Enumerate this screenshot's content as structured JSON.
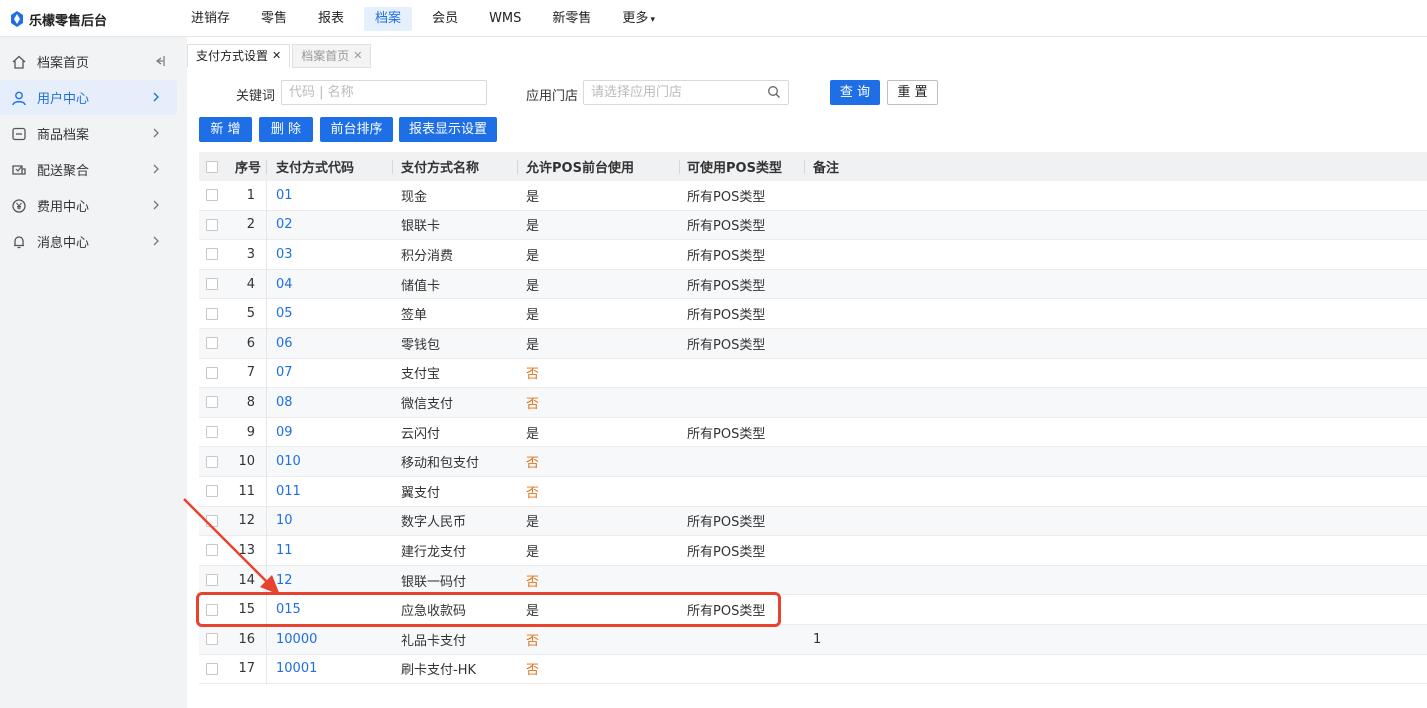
{
  "app": {
    "title": "乐檬零售后台"
  },
  "topnav": [
    {
      "label": "进销存",
      "active": false
    },
    {
      "label": "零售",
      "active": false
    },
    {
      "label": "报表",
      "active": false
    },
    {
      "label": "档案",
      "active": true
    },
    {
      "label": "会员",
      "active": false
    },
    {
      "label": "WMS",
      "active": false
    },
    {
      "label": "新零售",
      "active": false
    },
    {
      "label": "更多",
      "active": false
    }
  ],
  "sidebar": {
    "items": [
      {
        "label": "档案首页",
        "icon": "home-icon"
      },
      {
        "label": "用户中心",
        "icon": "user-icon",
        "active": true
      },
      {
        "label": "商品档案",
        "icon": "product-icon"
      },
      {
        "label": "配送聚合",
        "icon": "delivery-icon"
      },
      {
        "label": "费用中心",
        "icon": "yen-icon"
      },
      {
        "label": "消息中心",
        "icon": "bell-icon"
      }
    ]
  },
  "tabs": [
    {
      "label": "支付方式设置",
      "active": true
    },
    {
      "label": "档案首页",
      "active": false
    }
  ],
  "filter": {
    "keyword_label": "关键词",
    "keyword_placeholder": "代码 | 名称",
    "store_label": "应用门店",
    "store_placeholder": "请选择应用门店",
    "query_label": "查 询",
    "reset_label": "重 置"
  },
  "actions": {
    "add_label": "新 增",
    "delete_label": "删 除",
    "sort_label": "前台排序",
    "report_label": "报表显示设置"
  },
  "table": {
    "columns": [
      "序号",
      "支付方式代码",
      "支付方式名称",
      "允许POS前台使用",
      "可使用POS类型",
      "备注"
    ],
    "rows": [
      {
        "seq": "1",
        "code": "01",
        "name": "现金",
        "allow": "是",
        "pos_type": "所有POS类型",
        "remark": ""
      },
      {
        "seq": "2",
        "code": "02",
        "name": "银联卡",
        "allow": "是",
        "pos_type": "所有POS类型",
        "remark": ""
      },
      {
        "seq": "3",
        "code": "03",
        "name": "积分消费",
        "allow": "是",
        "pos_type": "所有POS类型",
        "remark": ""
      },
      {
        "seq": "4",
        "code": "04",
        "name": "储值卡",
        "allow": "是",
        "pos_type": "所有POS类型",
        "remark": ""
      },
      {
        "seq": "5",
        "code": "05",
        "name": "签单",
        "allow": "是",
        "pos_type": "所有POS类型",
        "remark": ""
      },
      {
        "seq": "6",
        "code": "06",
        "name": "零钱包",
        "allow": "是",
        "pos_type": "所有POS类型",
        "remark": ""
      },
      {
        "seq": "7",
        "code": "07",
        "name": "支付宝",
        "allow": "否",
        "pos_type": "",
        "remark": ""
      },
      {
        "seq": "8",
        "code": "08",
        "name": "微信支付",
        "allow": "否",
        "pos_type": "",
        "remark": ""
      },
      {
        "seq": "9",
        "code": "09",
        "name": "云闪付",
        "allow": "是",
        "pos_type": "所有POS类型",
        "remark": ""
      },
      {
        "seq": "10",
        "code": "010",
        "name": "移动和包支付",
        "allow": "否",
        "pos_type": "",
        "remark": ""
      },
      {
        "seq": "11",
        "code": "011",
        "name": "翼支付",
        "allow": "否",
        "pos_type": "",
        "remark": ""
      },
      {
        "seq": "12",
        "code": "10",
        "name": "数字人民币",
        "allow": "是",
        "pos_type": "所有POS类型",
        "remark": ""
      },
      {
        "seq": "13",
        "code": "11",
        "name": "建行龙支付",
        "allow": "是",
        "pos_type": "所有POS类型",
        "remark": ""
      },
      {
        "seq": "14",
        "code": "12",
        "name": "银联一码付",
        "allow": "否",
        "pos_type": "",
        "remark": ""
      },
      {
        "seq": "15",
        "code": "015",
        "name": "应急收款码",
        "allow": "是",
        "pos_type": "所有POS类型",
        "remark": ""
      },
      {
        "seq": "16",
        "code": "10000",
        "name": "礼品卡支付",
        "allow": "否",
        "pos_type": "",
        "remark": "1"
      },
      {
        "seq": "17",
        "code": "10001",
        "name": "刷卡支付-HK",
        "allow": "否",
        "pos_type": "",
        "remark": ""
      }
    ]
  },
  "colors": {
    "primary": "#1e6fe6",
    "no_text": "#e0731b",
    "highlight": "#e8432f"
  }
}
